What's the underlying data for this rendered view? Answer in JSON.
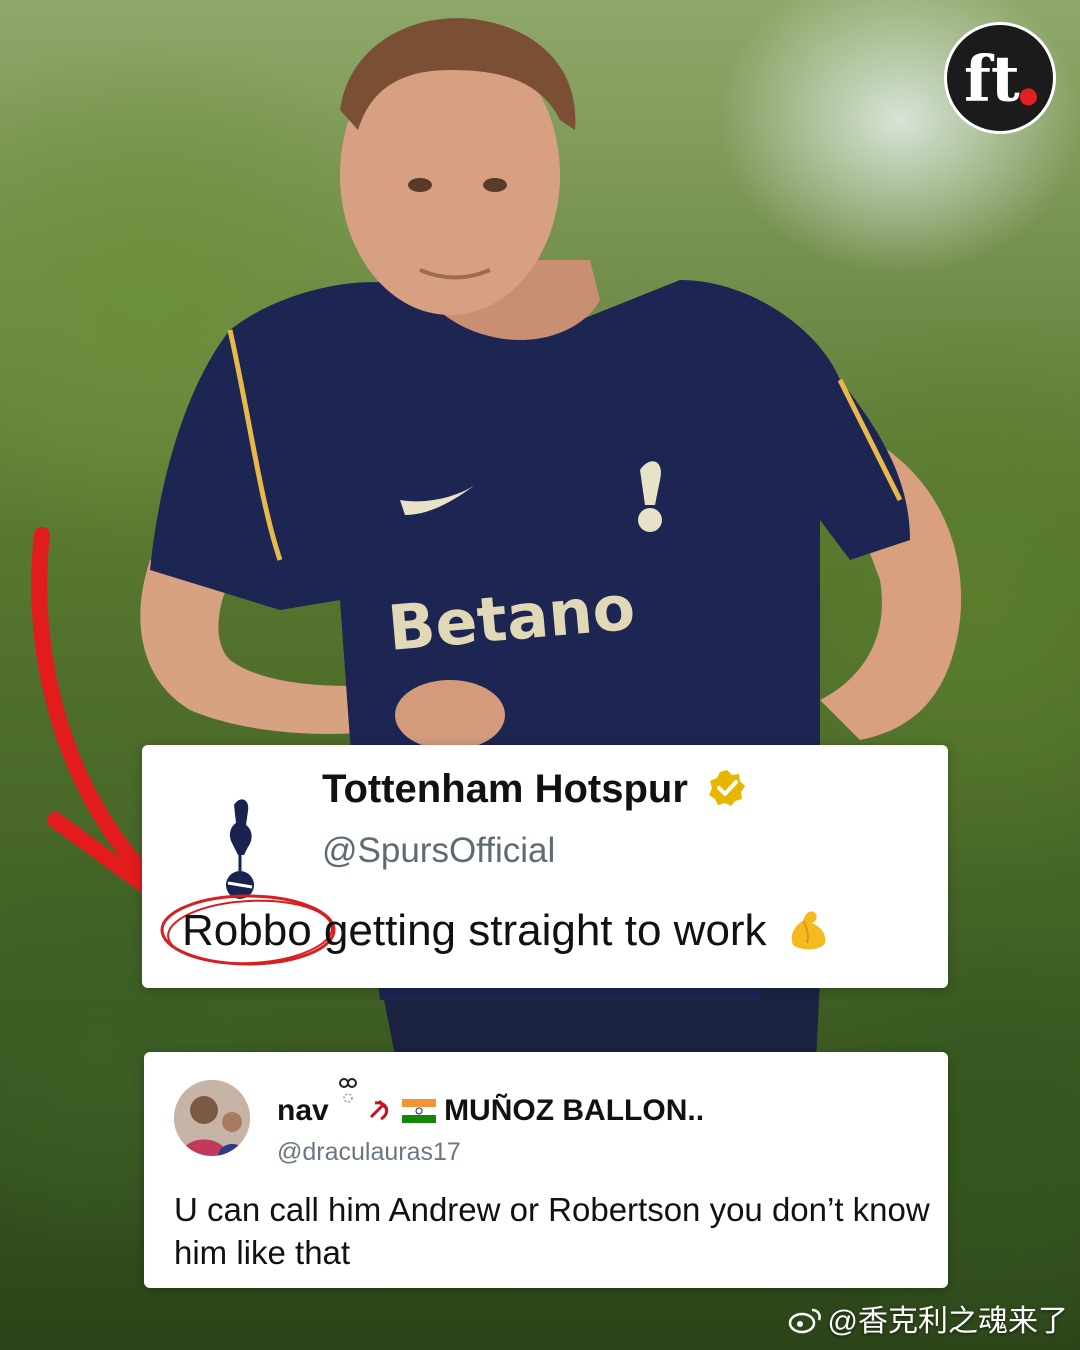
{
  "brand": {
    "logo_text": "ft",
    "accent": "#e02020"
  },
  "photo": {
    "jersey_sponsor": "Betano"
  },
  "post": {
    "account_name": "Tottenham Hotspur",
    "handle": "@SpursOfficial",
    "text_highlight": "Robbo",
    "text_rest": " getting straight to work",
    "verified_color": "#e8b500",
    "emoji_icon": "flexed-biceps-icon",
    "highlight_color": "#d81e1e"
  },
  "reply": {
    "name_prefix": "nav",
    "name_suffix": " MUÑOZ BALLON..",
    "handle": "@draculauras17",
    "text": "U can call him Andrew or Robertson you don’t know him like that"
  },
  "watermark": {
    "text": "@香克利之魂来了"
  }
}
